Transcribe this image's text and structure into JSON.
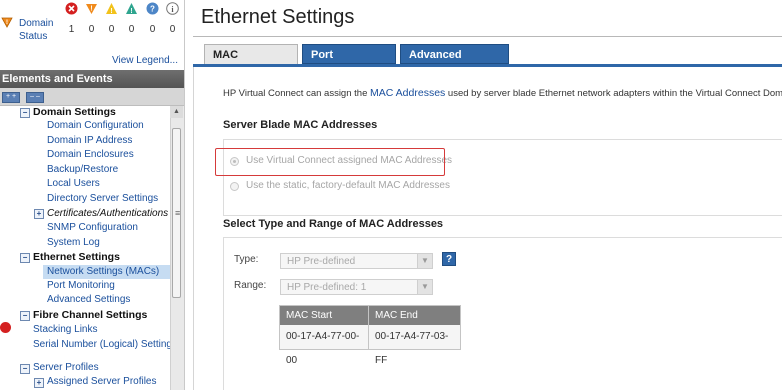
{
  "domain_status": {
    "label": "Domain Status",
    "severity_icons": [
      "critical-icon",
      "major-icon",
      "minor-icon",
      "warning-icon",
      "unknown-icon",
      "info-icon"
    ],
    "counts": [
      "1",
      "0",
      "0",
      "0",
      "0",
      "0"
    ],
    "view_legend": "View Legend..."
  },
  "left_panel": {
    "header": "Elements and Events",
    "expand_all": "+ +",
    "collapse_all": "– –",
    "tree": {
      "domain_settings": "Domain Settings",
      "domain_configuration": "Domain Configuration",
      "domain_ip_address": "Domain IP Address",
      "domain_enclosures": "Domain Enclosures",
      "backup_restore": "Backup/Restore",
      "local_users": "Local Users",
      "directory_server_settings": "Directory Server Settings",
      "certificates_authentications": "Certificates/Authentications",
      "snmp_configuration": "SNMP Configuration",
      "system_log": "System Log",
      "ethernet_settings": "Ethernet Settings",
      "network_settings_macs": "Network Settings (MACs)",
      "port_monitoring": "Port Monitoring",
      "advanced_settings": "Advanced Settings",
      "fibre_channel_settings": "Fibre Channel Settings",
      "stacking_links": "Stacking Links",
      "serial_number_logical_settings": "Serial Number (Logical) Settings",
      "server_profiles": "Server Profiles",
      "assigned_server_profiles": "Assigned Server Profiles"
    }
  },
  "main": {
    "title": "Ethernet Settings",
    "tabs": [
      {
        "label": "MAC Addresses",
        "active": true
      },
      {
        "label": "Port Monitoring",
        "active": false
      },
      {
        "label": "Advanced Settings",
        "active": false
      }
    ],
    "intro": {
      "before": "HP Virtual Connect can assign the",
      "link": "MAC Addresses",
      "after": "used by server blade Ethernet network adapters within the Virtual Connect Domain."
    },
    "server_blade_section": {
      "title": "Server Blade MAC Addresses",
      "options": [
        {
          "label": "Use Virtual Connect assigned MAC Addresses",
          "selected": true
        },
        {
          "label": "Use the static, factory-default MAC Addresses",
          "selected": false
        }
      ]
    },
    "type_range_section": {
      "title": "Select Type and Range of MAC Addresses",
      "type_label": "Type:",
      "type_value": "HP Pre-defined",
      "range_label": "Range:",
      "range_value": "HP Pre-defined: 1",
      "help": "?",
      "table": {
        "headers": [
          "MAC Start",
          "MAC End"
        ],
        "row": [
          "00-17-A4-77-00-00",
          "00-17-A4-77-03-FF"
        ]
      }
    }
  },
  "colors": {
    "tab_blue": "#2f67a8",
    "link_blue": "#1a4f9c",
    "highlight_red": "#d53a3a",
    "header_gray": "#5f5f5f"
  }
}
